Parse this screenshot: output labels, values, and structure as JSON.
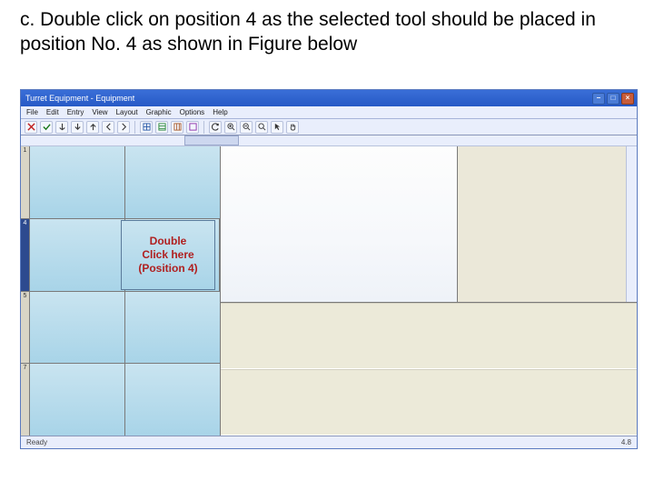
{
  "instruction": "c. Double click on position 4 as the selected tool should be placed in position No. 4 as shown in Figure below",
  "window": {
    "title": "Turret Equipment - Equipment",
    "menu": [
      "File",
      "Edit",
      "Entry",
      "View",
      "Layout",
      "Graphic",
      "Options",
      "Help"
    ],
    "status_left": "Ready",
    "status_right": "4.8"
  },
  "grid": {
    "rows": [
      {
        "num": "1"
      },
      {
        "num": "4",
        "selected": true
      },
      {
        "num": "5"
      },
      {
        "num": "7"
      }
    ]
  },
  "callout": {
    "line1": "Double",
    "line2": "Click here",
    "line3": "(Position 4)"
  },
  "toolbar_icons": [
    "close-icon",
    "check-icon",
    "anchor-icon",
    "down-arrow-icon",
    "up-arrow-icon",
    "left-icon",
    "right-icon",
    "sep",
    "grid1-icon",
    "grid2-icon",
    "grid3-icon",
    "grid4-icon",
    "sep",
    "refresh-icon",
    "zoom-in-icon",
    "zoom-out-icon",
    "fit-icon",
    "select-icon",
    "hand-icon"
  ]
}
